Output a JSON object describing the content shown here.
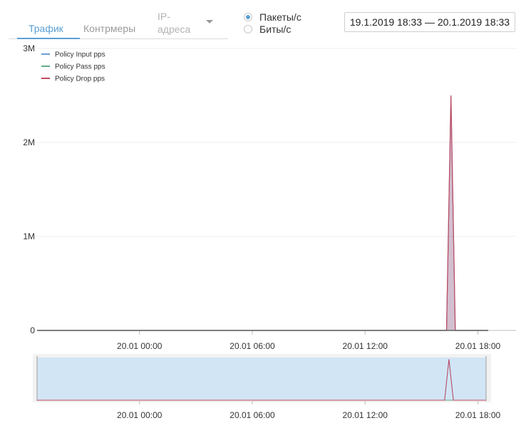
{
  "tabs": {
    "traffic": "Трафик",
    "countermeasures": "Контрмеры",
    "ip": "IP-адреса"
  },
  "units": {
    "packets": "Пакеты/с",
    "bits": "Биты/с",
    "selected": "packets"
  },
  "date_range": "19.1.2019 18:33 — 20.1.2019 18:33",
  "colors": {
    "accent": "#5a9fd4",
    "input": "#6a9fd8",
    "pass": "#5fae87",
    "drop": "#c0495f",
    "navigator_fill": "#d2e5f5"
  },
  "chart_data": {
    "type": "area",
    "title": "",
    "ylabel": "",
    "ylim": [
      0,
      3000000
    ],
    "yticks": [
      "0",
      "1M",
      "2M",
      "3M"
    ],
    "xticks": [
      "20.01 00:00",
      "20.01 06:00",
      "20.01 12:00",
      "20.01 18:00"
    ],
    "grid": true,
    "legend": "top-left",
    "series": [
      {
        "name": "Policy Input pps",
        "color": "#6a9fd8",
        "points": [
          [
            "19.01 18:33",
            0
          ],
          [
            "20.01 16:20",
            0
          ],
          [
            "20.01 16:34",
            2500000
          ],
          [
            "20.01 16:48",
            0
          ],
          [
            "20.01 18:33",
            0
          ]
        ]
      },
      {
        "name": "Policy Pass pps",
        "color": "#5fae87",
        "points": [
          [
            "19.01 18:33",
            0
          ],
          [
            "20.01 18:33",
            0
          ]
        ]
      },
      {
        "name": "Policy Drop pps",
        "color": "#c0495f",
        "points": [
          [
            "19.01 18:33",
            0
          ],
          [
            "20.01 16:20",
            0
          ],
          [
            "20.01 16:34",
            2500000
          ],
          [
            "20.01 16:48",
            0
          ],
          [
            "20.01 18:33",
            0
          ]
        ]
      }
    ],
    "navigator": {
      "xticks": [
        "20.01 00:00",
        "20.01 06:00",
        "20.01 12:00",
        "20.01 18:00"
      ]
    }
  }
}
